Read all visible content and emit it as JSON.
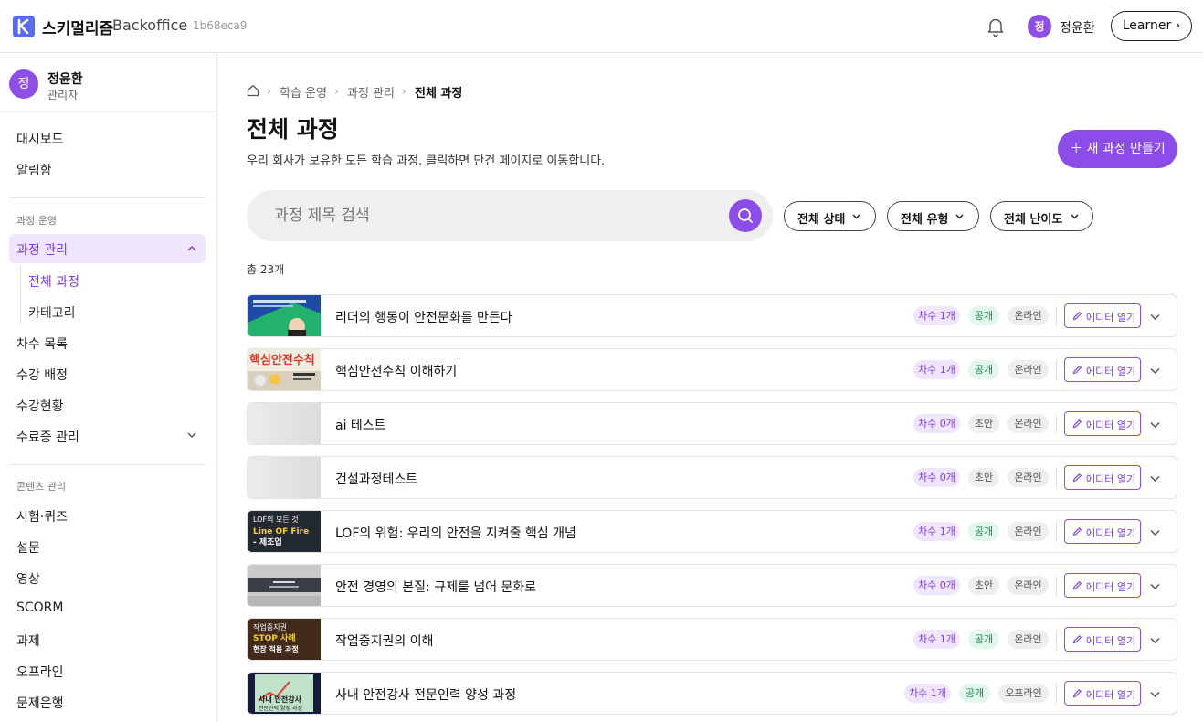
{
  "header": {
    "brand": "스키멀리즘",
    "brand_sub": "Backoffice",
    "build_hash": "1b68eca9",
    "user_initial": "정",
    "user_name": "정윤환",
    "learner_label": "Learner ›",
    "accent": "#8b4ce8"
  },
  "sidebar": {
    "profile": {
      "initial": "정",
      "name": "정윤환",
      "role": "관리자"
    },
    "top_items": [
      "대시보드",
      "알림함"
    ],
    "section_course": "과정 운영",
    "course_mgmt": "과정 관리",
    "course_sub": [
      "전체 과정",
      "카테고리"
    ],
    "course_items": [
      "차수 목록",
      "수강 배정",
      "수강현황",
      "수료증 관리"
    ],
    "section_content": "콘텐츠 관리",
    "content_items": [
      "시험·퀴즈",
      "설문",
      "영상",
      "SCORM",
      "과제",
      "오프라인",
      "문제은행"
    ]
  },
  "breadcrumb": {
    "items": [
      "학습 운영",
      "과정 관리"
    ],
    "current": "전체 과정"
  },
  "page": {
    "title": "전체 과정",
    "description": "우리 회사가 보유한 모든 학습 과정. 클릭하면 단건 페이지로 이동합니다.",
    "new_button": "＋ 새 과정 만들기"
  },
  "search": {
    "placeholder": "과정 제목 검색"
  },
  "filters": [
    "전체 상태",
    "전체 유형",
    "전체 난이도"
  ],
  "total": "총 23개",
  "editor_label": "에디터 열기",
  "courses": [
    {
      "title": "리더의 행동이 안전문화를 만든다",
      "round": "차수 1개",
      "status": "공개",
      "mode": "온라인"
    },
    {
      "title": "핵심안전수칙 이해하기",
      "round": "차수 1개",
      "status": "공개",
      "mode": "온라인"
    },
    {
      "title": "ai 테스트",
      "round": "차수 0개",
      "status": "초안",
      "mode": "온라인"
    },
    {
      "title": "건설과정테스트",
      "round": "차수 0개",
      "status": "초안",
      "mode": "온라인"
    },
    {
      "title": "LOF의 위험: 우리의 안전을 지켜줄 핵심 개념",
      "round": "차수 1개",
      "status": "공개",
      "mode": "온라인"
    },
    {
      "title": "안전 경영의 본질: 규제를 넘어 문화로",
      "round": "차수 0개",
      "status": "초안",
      "mode": "온라인"
    },
    {
      "title": "작업중지권의 이해",
      "round": "차수 1개",
      "status": "공개",
      "mode": "온라인"
    },
    {
      "title": "사내 안전강사 전문인력 양성 과정",
      "round": "차수 1개",
      "status": "공개",
      "mode": "오프라인"
    }
  ],
  "thumb_text": {
    "t2": "핵심안전수칙",
    "t5a": "LOF의 모든 것",
    "t5b": "Line OF Fire",
    "t5c": "- 제조업",
    "t7a": "작업중지권",
    "t7b": "STOP 사례",
    "t7c": "현장 적용 과정",
    "t8a": "사내 안전강사",
    "t8b": "전문인력 양성 과정"
  }
}
